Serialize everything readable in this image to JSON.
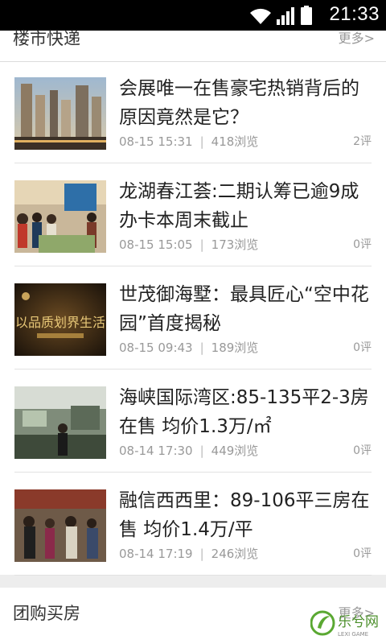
{
  "status_bar": {
    "time": "21:33"
  },
  "section1": {
    "title": "楼市快递",
    "more": "更多>",
    "items": [
      {
        "title": "会展唯一在售豪宅热销背后的原因竟然是它？",
        "time": "08-15 15:31",
        "views": "418浏览",
        "comments": "2评"
      },
      {
        "title": "龙湖春江荟:二期认筹已逾9成 办卡本周末截止",
        "time": "08-15 15:05",
        "views": "173浏览",
        "comments": "0评"
      },
      {
        "title": "世茂御海墅：最具匠心“空中花园”首度揭秘",
        "time": "08-15 09:43",
        "views": "189浏览",
        "comments": "0评"
      },
      {
        "title": "海峡国际湾区:85-135平2-3房在售 均价1.3万/㎡",
        "time": "08-14 17:30",
        "views": "449浏览",
        "comments": "0评"
      },
      {
        "title": "融信西西里：89-106平三房在售 均价1.4万/平",
        "time": "08-14 17:19",
        "views": "246浏览",
        "comments": "0评"
      }
    ]
  },
  "section2": {
    "title": "团购买房",
    "more": "更多>"
  },
  "thumb3_text": "以品质划界生活",
  "watermark": {
    "text": "乐兮网",
    "sub": "LEXI GAME"
  }
}
